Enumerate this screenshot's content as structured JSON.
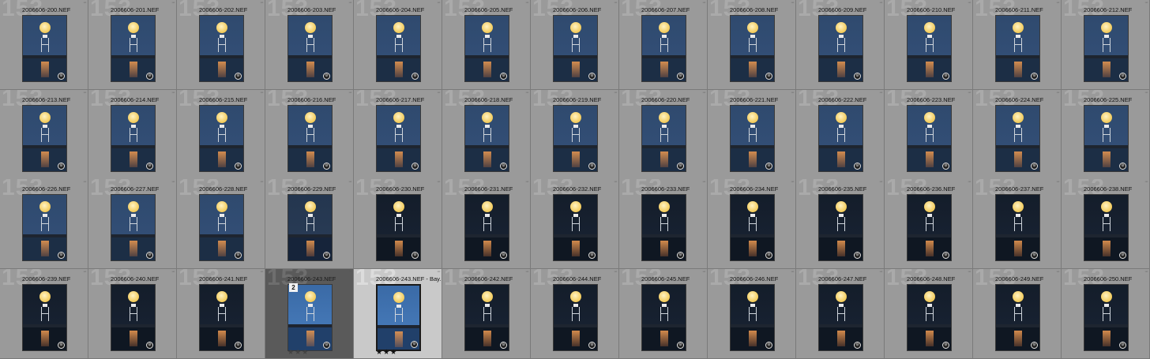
{
  "grid": {
    "columns": 13,
    "rows": 4
  },
  "icons": {
    "edit_badge": "slider-badge-icon",
    "more": "ellipsis-icon"
  },
  "colors": {
    "background": "#858585",
    "cell": "#9a9a9a",
    "group_lead": "#5a5a5a",
    "selected": "#c9c9c9"
  },
  "cells": [
    {
      "index": "153",
      "filename": "2006606-200.NEF",
      "tone": "blue"
    },
    {
      "index": "153",
      "filename": "2006606-201.NEF",
      "tone": "blue"
    },
    {
      "index": "153",
      "filename": "2006606-202.NEF",
      "tone": "blue"
    },
    {
      "index": "153",
      "filename": "2006606-203.NEF",
      "tone": "blue"
    },
    {
      "index": "153",
      "filename": "2006606-204.NEF",
      "tone": "blue"
    },
    {
      "index": "153",
      "filename": "2006606-205.NEF",
      "tone": "blue"
    },
    {
      "index": "153",
      "filename": "2006606-206.NEF",
      "tone": "blue"
    },
    {
      "index": "153",
      "filename": "2006606-207.NEF",
      "tone": "blue"
    },
    {
      "index": "153",
      "filename": "2006606-208.NEF",
      "tone": "blue"
    },
    {
      "index": "153",
      "filename": "2006606-209.NEF",
      "tone": "blue"
    },
    {
      "index": "153",
      "filename": "2006606-210.NEF",
      "tone": "blue"
    },
    {
      "index": "153",
      "filename": "2006606-211.NEF",
      "tone": "blue"
    },
    {
      "index": "153",
      "filename": "2006606-212.NEF",
      "tone": "blue"
    },
    {
      "index": "153",
      "filename": "2006606-213.NEF",
      "tone": "blue"
    },
    {
      "index": "153",
      "filename": "2006606-214.NEF",
      "tone": "blue"
    },
    {
      "index": "153",
      "filename": "2006606-215.NEF",
      "tone": "blue"
    },
    {
      "index": "153",
      "filename": "2006606-216.NEF",
      "tone": "blue"
    },
    {
      "index": "153",
      "filename": "2006606-217.NEF",
      "tone": "blue"
    },
    {
      "index": "153",
      "filename": "2006606-218.NEF",
      "tone": "blue"
    },
    {
      "index": "153",
      "filename": "2006606-219.NEF",
      "tone": "blue"
    },
    {
      "index": "153",
      "filename": "2006606-220.NEF",
      "tone": "blue"
    },
    {
      "index": "153",
      "filename": "2006606-221.NEF",
      "tone": "blue"
    },
    {
      "index": "153",
      "filename": "2006606-222.NEF",
      "tone": "blue"
    },
    {
      "index": "153",
      "filename": "2006606-223.NEF",
      "tone": "blue"
    },
    {
      "index": "153",
      "filename": "2006606-224.NEF",
      "tone": "blue"
    },
    {
      "index": "153",
      "filename": "2006606-225.NEF",
      "tone": "blue"
    },
    {
      "index": "153",
      "filename": "2006606-226.NEF",
      "tone": "blue"
    },
    {
      "index": "153",
      "filename": "2006606-227.NEF",
      "tone": "blue"
    },
    {
      "index": "153",
      "filename": "2006606-228.NEF",
      "tone": "blue"
    },
    {
      "index": "153",
      "filename": "2006606-229.NEF",
      "tone": "mid"
    },
    {
      "index": "153",
      "filename": "2006606-230.NEF",
      "tone": "dark"
    },
    {
      "index": "153",
      "filename": "2006606-231.NEF",
      "tone": "dark"
    },
    {
      "index": "153",
      "filename": "2006606-232.NEF",
      "tone": "dark"
    },
    {
      "index": "153",
      "filename": "2006606-233.NEF",
      "tone": "dark"
    },
    {
      "index": "153",
      "filename": "2006606-234.NEF",
      "tone": "dark"
    },
    {
      "index": "153",
      "filename": "2006606-235.NEF",
      "tone": "dark"
    },
    {
      "index": "153",
      "filename": "2006606-236.NEF",
      "tone": "dark"
    },
    {
      "index": "153",
      "filename": "2006606-237.NEF",
      "tone": "dark"
    },
    {
      "index": "153",
      "filename": "2006606-238.NEF",
      "tone": "dark"
    },
    {
      "index": "153",
      "filename": "2006606-239.NEF",
      "tone": "dark"
    },
    {
      "index": "153",
      "filename": "2006606-240.NEF",
      "tone": "dark"
    },
    {
      "index": "153",
      "filename": "2006606-241.NEF",
      "tone": "dark"
    },
    {
      "index": "153",
      "filename": "2006606-243.NEF",
      "tone": "bright",
      "group_lead": true,
      "stack_count": "2",
      "stars": "★★★"
    },
    {
      "index": "153",
      "filename": "2006606-243.NEF  -  Bay...",
      "tone": "bright",
      "selected": true,
      "stars": "★★★"
    },
    {
      "index": "153",
      "filename": "2006606-242.NEF",
      "tone": "dark"
    },
    {
      "index": "153",
      "filename": "2006606-244.NEF",
      "tone": "dark"
    },
    {
      "index": "153",
      "filename": "2006606-245.NEF",
      "tone": "dark"
    },
    {
      "index": "153",
      "filename": "2006606-246.NEF",
      "tone": "dark"
    },
    {
      "index": "153",
      "filename": "2006606-247.NEF",
      "tone": "dark"
    },
    {
      "index": "153",
      "filename": "2006606-248.NEF",
      "tone": "dark"
    },
    {
      "index": "153",
      "filename": "2006606-249.NEF",
      "tone": "dark"
    },
    {
      "index": "153",
      "filename": "2006606-250.NEF",
      "tone": "dark"
    }
  ]
}
